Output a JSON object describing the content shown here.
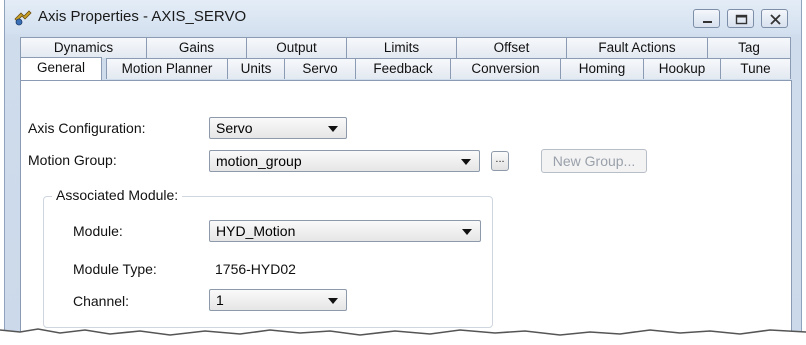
{
  "window": {
    "title": "Axis Properties - AXIS_SERVO",
    "controls": {
      "minimize": "minimize-icon",
      "maximize": "maximize-icon",
      "close": "close-icon"
    }
  },
  "tabs": {
    "back_row": [
      "Dynamics",
      "Gains",
      "Output",
      "Limits",
      "Offset",
      "Fault Actions",
      "Tag"
    ],
    "front_row": [
      "General",
      "Motion Planner",
      "Units",
      "Servo",
      "Feedback",
      "Conversion",
      "Homing",
      "Hookup",
      "Tune"
    ],
    "active": "General"
  },
  "general": {
    "axis_configuration": {
      "label": "Axis Configuration:",
      "value": "Servo"
    },
    "motion_group": {
      "label": "Motion Group:",
      "value": "motion_group",
      "browse_label": "...",
      "new_group_label": "New Group..."
    },
    "associated_module": {
      "title": "Associated Module:",
      "module": {
        "label": "Module:",
        "value": "HYD_Motion"
      },
      "module_type": {
        "label": "Module Type:",
        "value": "1756-HYD02"
      },
      "channel": {
        "label": "Channel:",
        "value": "1"
      }
    }
  },
  "colors": {
    "frame": "#cbd9ea",
    "tab_border": "#8a9bb3",
    "disabled_text": "#9aa1aa"
  }
}
